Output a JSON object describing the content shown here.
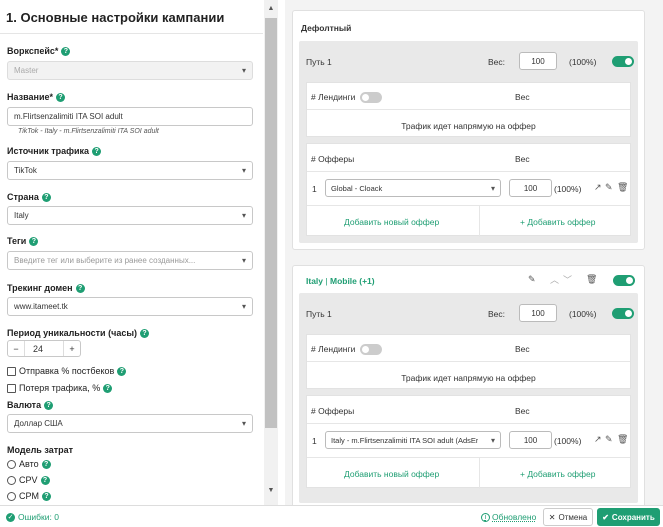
{
  "section_title": "1. Основные настройки кампании",
  "workspace": {
    "label": "Воркспейс*",
    "value": "Master"
  },
  "name": {
    "label": "Название*",
    "value": "m.Flirtsenzalimiti ITA SOI adult",
    "hint": "TikTok - Italy - m.Flirtsenzalimiti ITA SOI adult"
  },
  "traffic_source": {
    "label": "Источник трафика",
    "value": "TikTok"
  },
  "country": {
    "label": "Страна",
    "value": "Italy"
  },
  "tags": {
    "label": "Теги",
    "placeholder": "Введите тег или выберите из ранее созданных..."
  },
  "tracking_domain": {
    "label": "Трекинг домен",
    "value": "www.itameet.tk"
  },
  "uniqueness": {
    "label": "Период уникальности (часы)",
    "minus": "−",
    "value": "24",
    "plus": "+"
  },
  "postback_checkbox": {
    "label": "Отправка % постбеков"
  },
  "traffic_loss_checkbox": {
    "label": "Потеря трафика, %"
  },
  "currency": {
    "label": "Валюта",
    "value": "Доллар США"
  },
  "cost_model": {
    "label": "Модель затрат",
    "options": [
      "Авто",
      "CPV",
      "CPM"
    ]
  },
  "default_flow": {
    "title": "Дефолтный",
    "path_label": "Путь 1",
    "weight_label": "Вес:",
    "weight_value": "100",
    "weight_pct": "(100%)",
    "landings_label": "# Лендинги",
    "landings_weight": "Вес",
    "direct_text": "Трафик идет напрямую на оффер",
    "offers_label": "# Офферы",
    "offers_weight": "Вес",
    "offer_index": "1",
    "offer_name": "Global - Cloack",
    "offer_weight": "100",
    "offer_pct": "(100%)",
    "add_new_offer": "Добавить новый оффер",
    "add_offer": "+ Добавить оффер"
  },
  "italy_flow": {
    "title_country": "Italy",
    "title_sep": "|",
    "title_rest": "Mobile (+1)",
    "path_label": "Путь 1",
    "weight_label": "Вес:",
    "weight_value": "100",
    "weight_pct": "(100%)",
    "landings_label": "# Лендинги",
    "landings_weight": "Вес",
    "direct_text": "Трафик идет напрямую на оффер",
    "offers_label": "# Офферы",
    "offers_weight": "Вес",
    "offer_index": "1",
    "offer_name": "Italy - m.Flirtsenzalimiti ITA SOI adult (AdsEr",
    "offer_weight": "100",
    "offer_pct": "(100%)",
    "add_new_offer": "Добавить новый оффер",
    "add_offer": "+ Добавить оффер"
  },
  "footer": {
    "errors": "Ошибки: 0",
    "updated": "Обновлено",
    "cancel": "Отмена",
    "save": "Сохранить"
  },
  "colors": {
    "accent": "#1f9e73",
    "help": "#1f9e73"
  }
}
